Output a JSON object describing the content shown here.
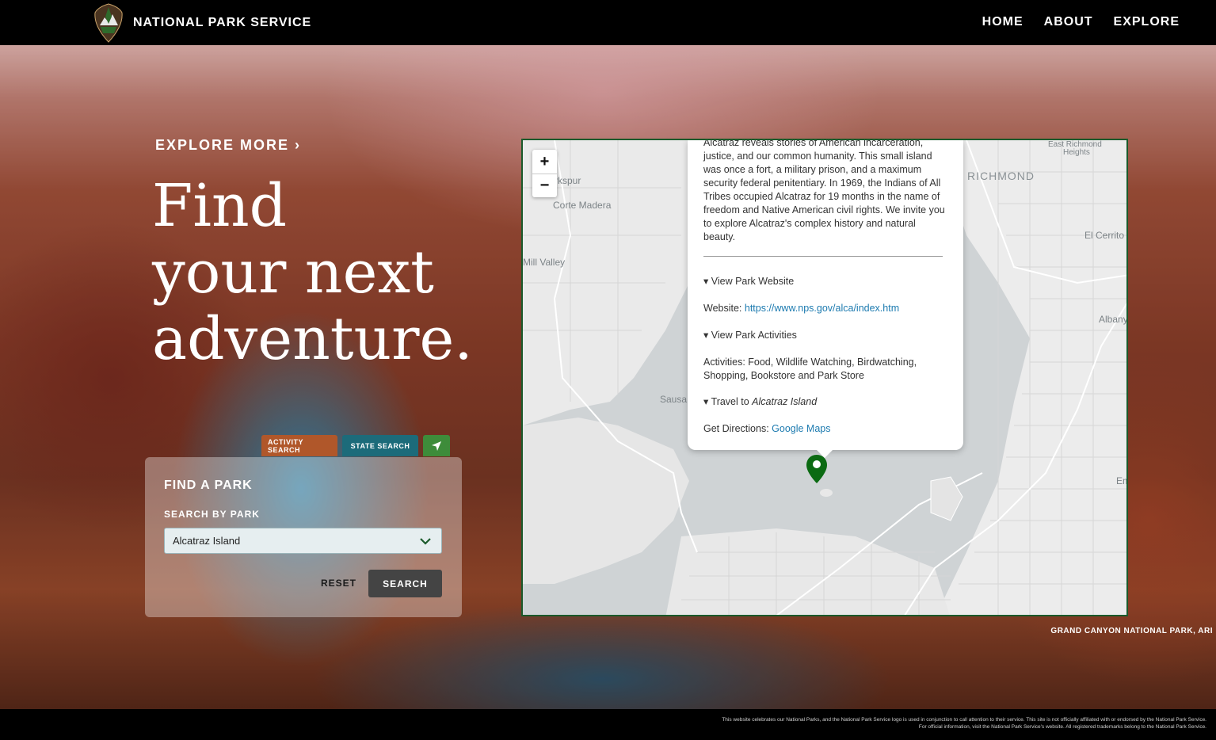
{
  "header": {
    "brand": "NATIONAL PARK SERVICE",
    "nav": [
      "HOME",
      "ABOUT",
      "EXPLORE"
    ]
  },
  "hero": {
    "explore_more": "EXPLORE MORE ›",
    "headline": [
      "Find",
      "your next",
      "adventure."
    ],
    "caption": "GRAND CANYON NATIONAL PARK, ARI"
  },
  "search": {
    "tabs": [
      "ACTIVITY SEARCH",
      "STATE SEARCH"
    ],
    "locate_icon": "location-arrow-icon",
    "title": "FIND A PARK",
    "label": "SEARCH BY PARK",
    "selected": "Alcatraz Island",
    "reset": "RESET",
    "submit": "SEARCH"
  },
  "map": {
    "zoom_in": "+",
    "zoom_out": "−",
    "labels": {
      "larkspur": "rkspur",
      "corte_madera": "Corte Madera",
      "mill_valley": "Mill Valley",
      "sausalito": "Sausa",
      "richmond": "RICHMOND",
      "east_richmond": "East Richmond",
      "heights": "Heights",
      "el_cerrito": "El Cerrito",
      "albany": "Albany",
      "emeryville": "Em"
    },
    "popup": {
      "description": "Alcatraz reveals stories of American incarceration, justice, and our common humanity. This small island was once a fort, a military prison, and a maximum security federal penitentiary. In 1969, the Indians of All Tribes occupied Alcatraz for 19 months in the name of freedom and Native American civil rights. We invite you to explore Alcatraz's complex history and natural beauty.",
      "website_toggle": "▾ View Park Website",
      "website_label": "Website: ",
      "website_url": "https://www.nps.gov/alca/index.htm",
      "activities_toggle": "▾ View Park Activities",
      "activities": "Activities: Food, Wildlife Watching, Birdwatching, Shopping, Bookstore and Park Store",
      "travel_toggle_prefix": "▾ Travel to ",
      "travel_place": "Alcatraz Island",
      "directions_label": "Get Directions: ",
      "directions_link": "Google Maps"
    }
  },
  "footer": {
    "disclaimer": "This website celebrates our National Parks, and the National Park Service logo is used in conjunction to call attention to their service. This site is not officially affiliated with or endorsed by the National Park Service. For official information, visit the National Park Service's website. All registered trademarks belong to the National Park Service."
  },
  "colors": {
    "activity_tab": "#b0572a",
    "state_tab": "#1c6b7a",
    "locate_tab": "#3e8c3a",
    "map_border": "#1b5a2b",
    "marker": "#0b6a12",
    "link": "#1d7bb0"
  }
}
